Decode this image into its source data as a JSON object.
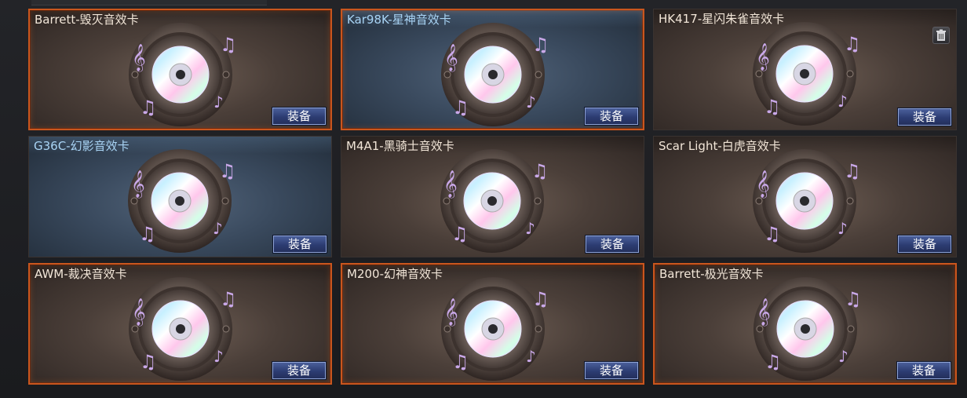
{
  "inventory": {
    "equip_label": "装备",
    "cards": [
      {
        "title": "Barrett-毁灭音效卡",
        "rarity": "orange",
        "has_delete": false
      },
      {
        "title": "Kar98K-星神音效卡",
        "rarity": "blue-orange",
        "has_delete": false
      },
      {
        "title": "HK417-星闪朱雀音效卡",
        "rarity": "plain",
        "has_delete": true
      },
      {
        "title": "G36C-幻影音效卡",
        "rarity": "blue",
        "has_delete": false
      },
      {
        "title": "M4A1-黑骑士音效卡",
        "rarity": "plain",
        "has_delete": false
      },
      {
        "title": "Scar Light-白虎音效卡",
        "rarity": "plain",
        "has_delete": false
      },
      {
        "title": "AWM-裁决音效卡",
        "rarity": "orange",
        "has_delete": false
      },
      {
        "title": "M200-幻神音效卡",
        "rarity": "orange",
        "has_delete": false
      },
      {
        "title": "Barrett-极光音效卡",
        "rarity": "orange",
        "has_delete": false
      }
    ]
  },
  "icons": {
    "card_art": "speaker-cd-icon",
    "delete": "trash-icon"
  },
  "colors": {
    "equip_button": "#2c3c72",
    "orange_border": "#c9561e",
    "blue_title": "#a9d4f5"
  }
}
